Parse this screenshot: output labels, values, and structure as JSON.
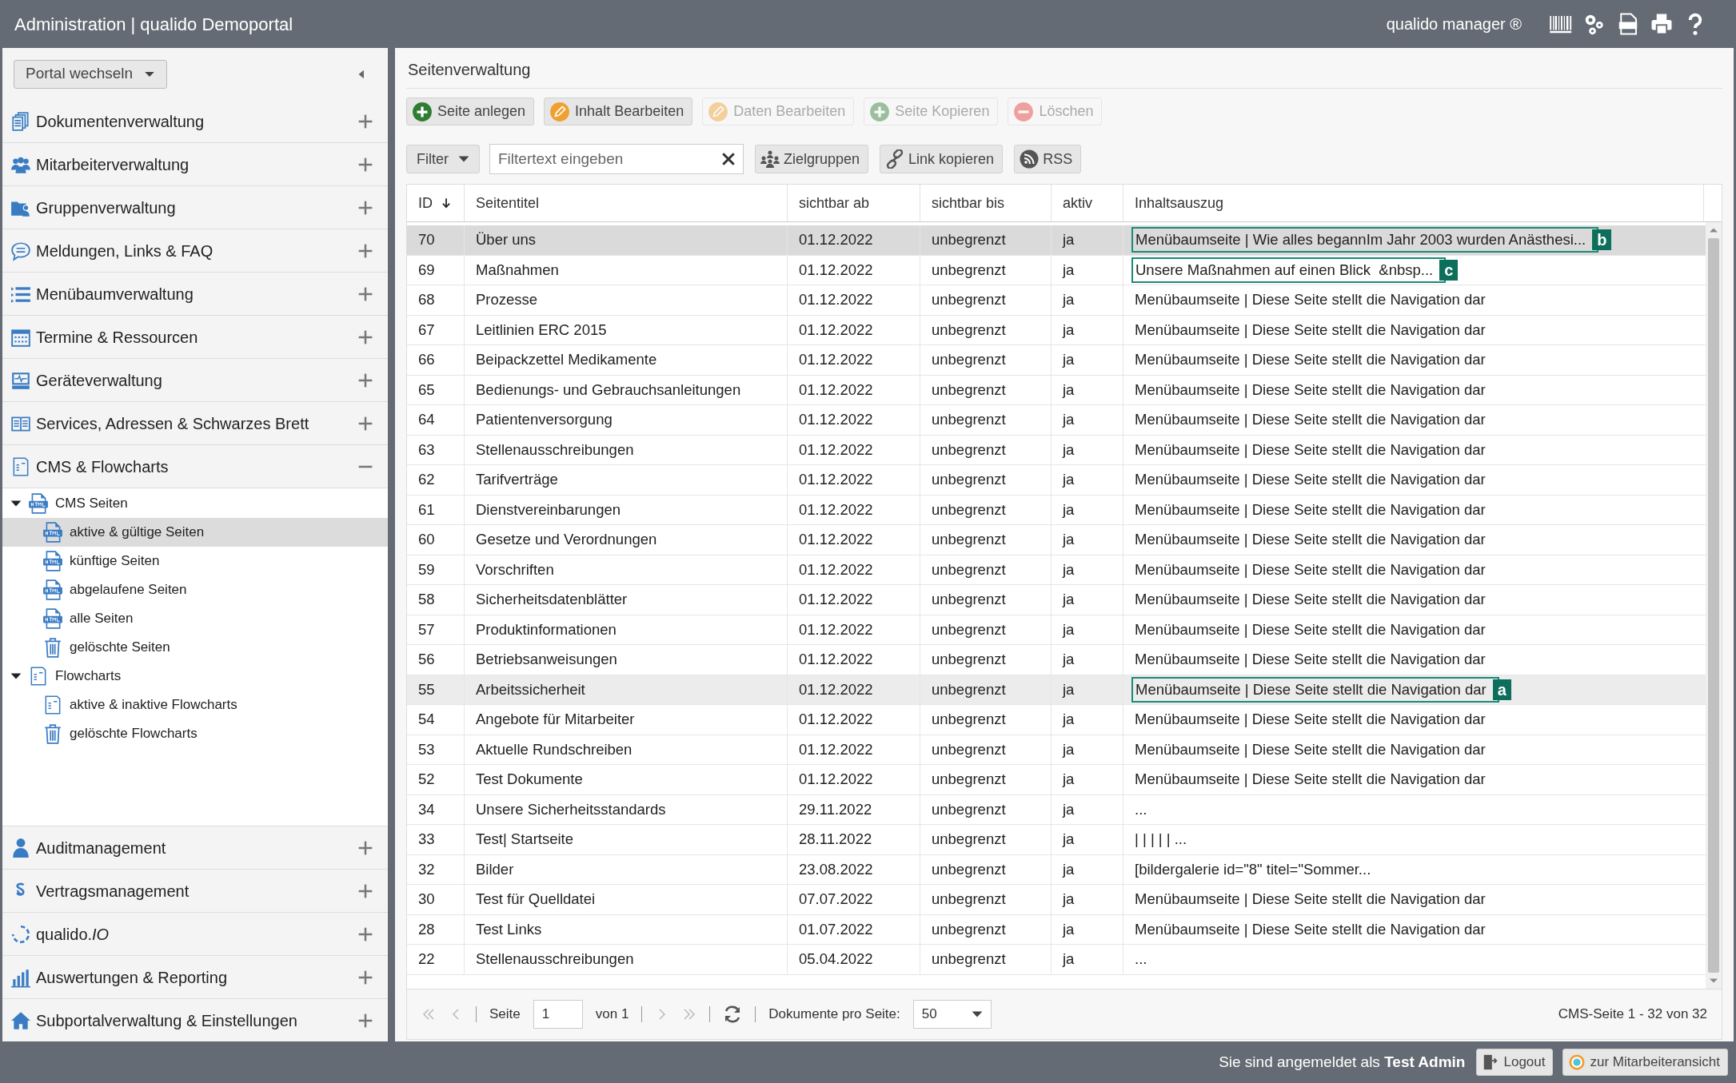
{
  "header": {
    "title": "Administration | qualido Demoportal",
    "product": "qualido manager ®"
  },
  "sidebar": {
    "portal_switch": "Portal wechseln",
    "items": [
      {
        "label": "Dokumentenverwaltung",
        "expanded": false
      },
      {
        "label": "Mitarbeiterverwaltung",
        "expanded": false
      },
      {
        "label": "Gruppenverwaltung",
        "expanded": false
      },
      {
        "label": "Meldungen, Links & FAQ",
        "expanded": false
      },
      {
        "label": "Menübaumverwaltung",
        "expanded": false
      },
      {
        "label": "Termine & Ressourcen",
        "expanded": false
      },
      {
        "label": "Geräteverwaltung",
        "expanded": false
      },
      {
        "label": "Services, Adressen & Schwarzes Brett",
        "expanded": false
      },
      {
        "label": "CMS & Flowcharts",
        "expanded": true,
        "children": [
          {
            "label": "CMS Seiten",
            "kind": "html",
            "expanded": true,
            "children": [
              {
                "label": "aktive & gültige Seiten",
                "kind": "html",
                "selected": true
              },
              {
                "label": "künftige Seiten",
                "kind": "html",
                "selected": false
              },
              {
                "label": "abgelaufene Seiten",
                "kind": "html",
                "selected": false
              },
              {
                "label": "alle Seiten",
                "kind": "html",
                "selected": false
              },
              {
                "label": "gelöschte Seiten",
                "kind": "trash",
                "selected": false
              }
            ]
          },
          {
            "label": "Flowcharts",
            "kind": "flow",
            "expanded": true,
            "children": [
              {
                "label": "aktive & inaktive Flowcharts",
                "kind": "flow",
                "selected": false
              },
              {
                "label": "gelöschte Flowcharts",
                "kind": "trash",
                "selected": false
              }
            ]
          }
        ]
      }
    ],
    "bottom_items": [
      {
        "label": "Auditmanagement",
        "expanded": false
      },
      {
        "label": "Vertragsmanagement",
        "expanded": false
      },
      {
        "label": "qualido.*IO*",
        "expanded": false
      },
      {
        "label": "Auswertungen & Reporting",
        "expanded": false
      },
      {
        "label": "Subportalverwaltung & Einstellungen",
        "expanded": false
      }
    ]
  },
  "content": {
    "title": "Seitenverwaltung",
    "actions": [
      {
        "label": "Seite anlegen",
        "disabled": false
      },
      {
        "label": "Inhalt Bearbeiten",
        "disabled": false
      },
      {
        "label": "Daten Bearbeiten",
        "disabled": true
      },
      {
        "label": "Seite Kopieren",
        "disabled": true
      },
      {
        "label": "Löschen",
        "disabled": true
      }
    ],
    "filter": {
      "label": "Filter",
      "placeholder": "Filtertext eingeben"
    },
    "tools": [
      "Zielgruppen",
      "Link kopieren",
      "RSS"
    ],
    "table": {
      "columns": [
        "ID",
        "Seitentitel",
        "sichtbar ab",
        "sichtbar bis",
        "aktiv",
        "Inhaltsauszug"
      ],
      "rows": [
        {
          "cells": [
            "70",
            "Über uns",
            "01.12.2022",
            "unbegrenzt",
            "ja",
            "Menübaumseite | Wie alles begannIm Jahr 2003 wurden Anästhesi..."
          ],
          "selected": true,
          "hovered": false,
          "marker": "b"
        },
        {
          "cells": [
            "69",
            "Maßnahmen",
            "01.12.2022",
            "unbegrenzt",
            "ja",
            "Unsere Maßnahmen auf einen Blick  &nbsp..."
          ],
          "selected": false,
          "hovered": false,
          "marker": "c"
        },
        {
          "cells": [
            "68",
            "Prozesse",
            "01.12.2022",
            "unbegrenzt",
            "ja",
            "Menübaumseite | Diese Seite stellt die Navigation dar"
          ],
          "selected": false,
          "hovered": false
        },
        {
          "cells": [
            "67",
            "Leitlinien ERC 2015",
            "01.12.2022",
            "unbegrenzt",
            "ja",
            "Menübaumseite | Diese Seite stellt die Navigation dar"
          ],
          "selected": false,
          "hovered": false
        },
        {
          "cells": [
            "66",
            "Beipackzettel Medikamente",
            "01.12.2022",
            "unbegrenzt",
            "ja",
            "Menübaumseite | Diese Seite stellt die Navigation dar"
          ],
          "selected": false,
          "hovered": false
        },
        {
          "cells": [
            "65",
            "Bedienungs- und Gebrauchsanleitungen",
            "01.12.2022",
            "unbegrenzt",
            "ja",
            "Menübaumseite | Diese Seite stellt die Navigation dar"
          ],
          "selected": false,
          "hovered": false
        },
        {
          "cells": [
            "64",
            "Patientenversorgung",
            "01.12.2022",
            "unbegrenzt",
            "ja",
            "Menübaumseite | Diese Seite stellt die Navigation dar"
          ],
          "selected": false,
          "hovered": false
        },
        {
          "cells": [
            "63",
            "Stellenausschreibungen",
            "01.12.2022",
            "unbegrenzt",
            "ja",
            "Menübaumseite | Diese Seite stellt die Navigation dar"
          ],
          "selected": false,
          "hovered": false
        },
        {
          "cells": [
            "62",
            "Tarifverträge",
            "01.12.2022",
            "unbegrenzt",
            "ja",
            "Menübaumseite | Diese Seite stellt die Navigation dar"
          ],
          "selected": false,
          "hovered": false
        },
        {
          "cells": [
            "61",
            "Dienstvereinbarungen",
            "01.12.2022",
            "unbegrenzt",
            "ja",
            "Menübaumseite | Diese Seite stellt die Navigation dar"
          ],
          "selected": false,
          "hovered": false
        },
        {
          "cells": [
            "60",
            "Gesetze und Verordnungen",
            "01.12.2022",
            "unbegrenzt",
            "ja",
            "Menübaumseite | Diese Seite stellt die Navigation dar"
          ],
          "selected": false,
          "hovered": false
        },
        {
          "cells": [
            "59",
            "Vorschriften",
            "01.12.2022",
            "unbegrenzt",
            "ja",
            "Menübaumseite | Diese Seite stellt die Navigation dar"
          ],
          "selected": false,
          "hovered": false
        },
        {
          "cells": [
            "58",
            "Sicherheitsdatenblätter",
            "01.12.2022",
            "unbegrenzt",
            "ja",
            "Menübaumseite | Diese Seite stellt die Navigation dar"
          ],
          "selected": false,
          "hovered": false
        },
        {
          "cells": [
            "57",
            "Produktinformationen",
            "01.12.2022",
            "unbegrenzt",
            "ja",
            "Menübaumseite | Diese Seite stellt die Navigation dar"
          ],
          "selected": false,
          "hovered": false
        },
        {
          "cells": [
            "56",
            "Betriebsanweisungen",
            "01.12.2022",
            "unbegrenzt",
            "ja",
            "Menübaumseite | Diese Seite stellt die Navigation dar"
          ],
          "selected": false,
          "hovered": false
        },
        {
          "cells": [
            "55",
            "Arbeitssicherheit",
            "01.12.2022",
            "unbegrenzt",
            "ja",
            "Menübaumseite | Diese Seite stellt die Navigation dar"
          ],
          "selected": false,
          "hovered": true,
          "marker": "a"
        },
        {
          "cells": [
            "54",
            "Angebote für Mitarbeiter",
            "01.12.2022",
            "unbegrenzt",
            "ja",
            "Menübaumseite | Diese Seite stellt die Navigation dar"
          ],
          "selected": false,
          "hovered": false
        },
        {
          "cells": [
            "53",
            "Aktuelle Rundschreiben",
            "01.12.2022",
            "unbegrenzt",
            "ja",
            "Menübaumseite | Diese Seite stellt die Navigation dar"
          ],
          "selected": false,
          "hovered": false
        },
        {
          "cells": [
            "52",
            "Test Dokumente",
            "01.12.2022",
            "unbegrenzt",
            "ja",
            "Menübaumseite | Diese Seite stellt die Navigation dar"
          ],
          "selected": false,
          "hovered": false
        },
        {
          "cells": [
            "34",
            "Unsere Sicherheitsstandards",
            "29.11.2022",
            "unbegrenzt",
            "ja",
            "..."
          ],
          "selected": false,
          "hovered": false
        },
        {
          "cells": [
            "33",
            "Test| Startseite",
            "28.11.2022",
            "unbegrenzt",
            "ja",
            "| | | | | ..."
          ],
          "selected": false,
          "hovered": false
        },
        {
          "cells": [
            "32",
            "Bilder",
            "23.08.2022",
            "unbegrenzt",
            "ja",
            "[bildergalerie id=\"8\" titel=\"Sommer..."
          ],
          "selected": false,
          "hovered": false
        },
        {
          "cells": [
            "30",
            "Test für Quelldatei",
            "07.07.2022",
            "unbegrenzt",
            "ja",
            "Menübaumseite | Diese Seite stellt die Navigation dar"
          ],
          "selected": false,
          "hovered": false
        },
        {
          "cells": [
            "28",
            "Test Links",
            "01.07.2022",
            "unbegrenzt",
            "ja",
            "Menübaumseite | Diese Seite stellt die Navigation dar"
          ],
          "selected": false,
          "hovered": false
        },
        {
          "cells": [
            "22",
            "Stellenausschreibungen",
            "05.04.2022",
            "unbegrenzt",
            "ja",
            "..."
          ],
          "selected": false,
          "hovered": false
        }
      ]
    },
    "pager": {
      "page_label": "Seite",
      "page": "1",
      "of": "von 1",
      "per_page_label": "Dokumente pro Seite:",
      "per_page": "50",
      "summary": "CMS-Seite 1 - 32 von 32"
    }
  },
  "footer": {
    "login_text": "Sie sind angemeldet als **Test Admin**",
    "buttons": [
      "Logout",
      "zur Mitarbeiteransicht"
    ]
  }
}
